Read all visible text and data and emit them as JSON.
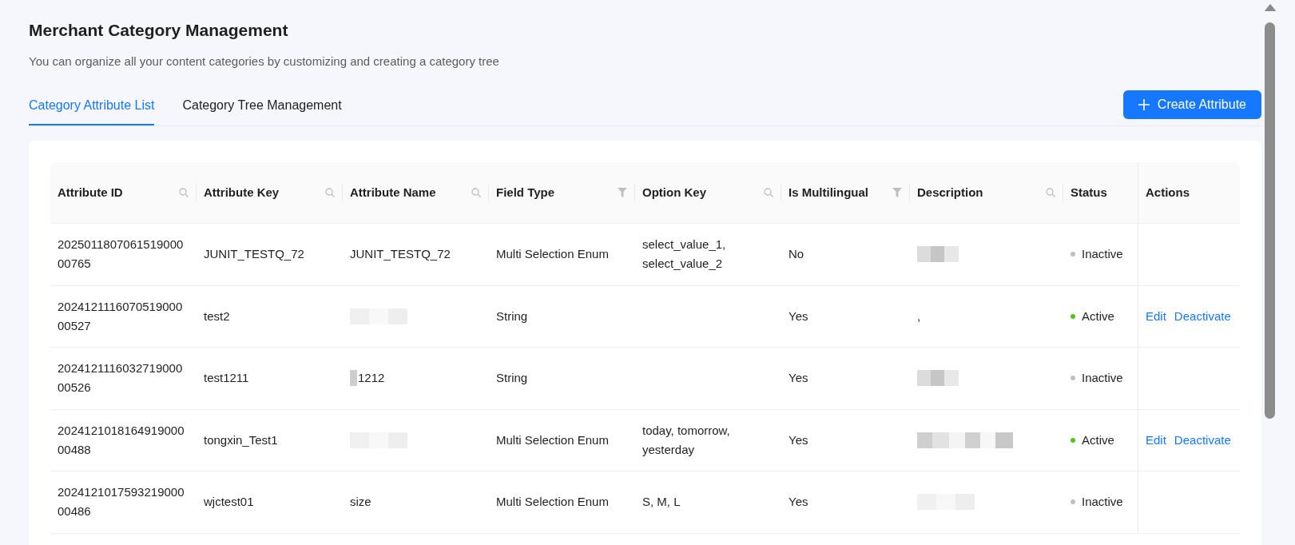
{
  "page": {
    "title": "Merchant Category Management",
    "subtitle": "You can organize all your content categories by customizing and creating a category tree"
  },
  "tabs": [
    {
      "label": "Category Attribute List",
      "selected": true
    },
    {
      "label": "Category Tree Management",
      "selected": false
    }
  ],
  "create_button": {
    "label": "Create Attribute"
  },
  "table": {
    "columns": [
      {
        "label": "Attribute ID",
        "kind": "search"
      },
      {
        "label": "Attribute Key",
        "kind": "search"
      },
      {
        "label": "Attribute Name",
        "kind": "search"
      },
      {
        "label": "Field Type",
        "kind": "filter"
      },
      {
        "label": "Option Key",
        "kind": "search"
      },
      {
        "label": "Is Multilingual",
        "kind": "filter"
      },
      {
        "label": "Description",
        "kind": "search"
      },
      {
        "label": "Status",
        "kind": "plain"
      },
      {
        "label": "Actions",
        "kind": "plain"
      }
    ],
    "rows": [
      {
        "attribute_id": "202501180706151900000765",
        "attribute_key": "JUNIT_TESTQ_72",
        "attribute_name": [
          {
            "kind": "text",
            "text": "JUNIT_TESTQ_72"
          }
        ],
        "field_type": "Multi Selection Enum",
        "option_key": "select_value_1, select_value_2",
        "is_multilingual": "No",
        "description": [
          {
            "kind": "mosaic"
          }
        ],
        "status": {
          "label": "Inactive",
          "color": "#bfbfbf"
        }
      },
      {
        "attribute_id": "202412111607051900000527",
        "attribute_key": "test2",
        "attribute_name": [
          {
            "kind": "faint_mosaic"
          }
        ],
        "field_type": "String",
        "is_multilingual": "Yes",
        "description": [
          {
            "kind": "text",
            "text": ","
          }
        ],
        "status": {
          "label": "Active",
          "color": "#52c41a"
        },
        "actions": [
          "Edit",
          "Deactivate"
        ]
      },
      {
        "attribute_id": "202412111603271900000526",
        "attribute_key": "test1211",
        "attribute_name": [
          {
            "kind": "narrow_mosaic"
          },
          {
            "kind": "text",
            "text": "1212"
          }
        ],
        "field_type": "String",
        "is_multilingual": "Yes",
        "description": [
          {
            "kind": "mosaic"
          }
        ],
        "status": {
          "label": "Inactive",
          "color": "#bfbfbf"
        }
      },
      {
        "attribute_id": "202412101816491900000488",
        "attribute_key": "tongxin_Test1",
        "attribute_name": [
          {
            "kind": "faint_mosaic"
          }
        ],
        "field_type": "Multi Selection Enum",
        "option_key": "today, tomorrow, yesterday",
        "is_multilingual": "Yes",
        "description": [
          {
            "kind": "wide_mosaic"
          }
        ],
        "status": {
          "label": "Active",
          "color": "#52c41a"
        },
        "actions": [
          "Edit",
          "Deactivate"
        ]
      },
      {
        "attribute_id": "202412101759321900000486",
        "attribute_key": "wjctest01",
        "attribute_name": [
          {
            "kind": "text",
            "text": "size"
          }
        ],
        "field_type": "Multi Selection Enum",
        "option_key": "S, M, L",
        "is_multilingual": "Yes",
        "description": [
          {
            "kind": "faint_mosaic"
          }
        ],
        "status": {
          "label": "Inactive",
          "color": "#bfbfbf"
        }
      }
    ]
  }
}
